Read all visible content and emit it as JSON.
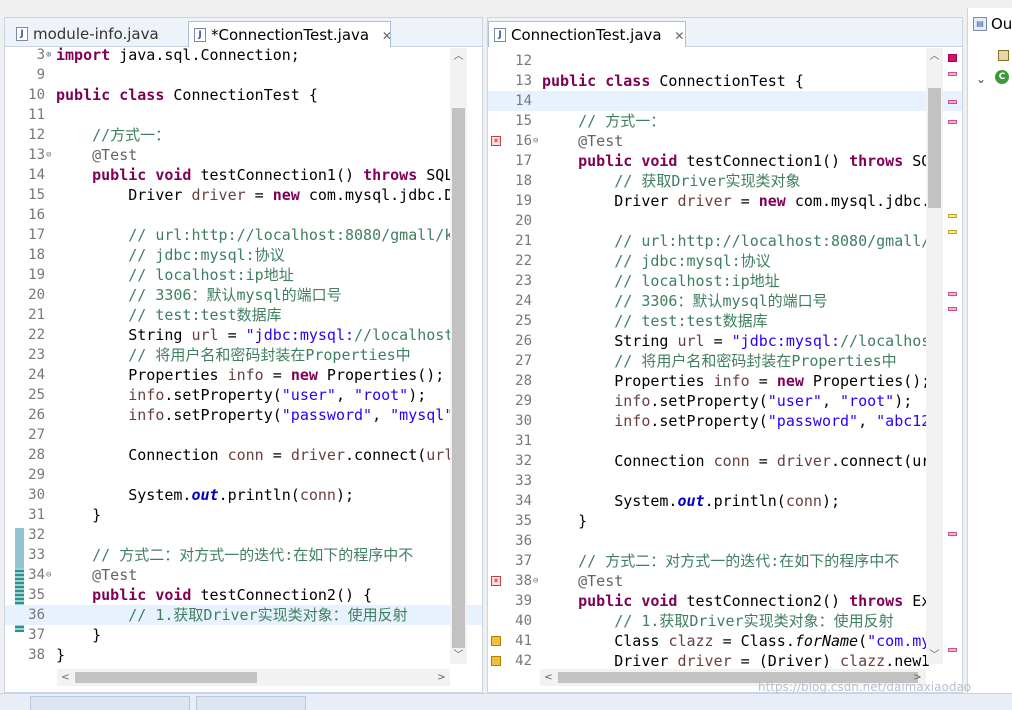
{
  "left_editor": {
    "tabs": [
      {
        "label": "module-info.java",
        "active": false
      },
      {
        "label": "*ConnectionTest.java",
        "active": true
      }
    ],
    "lines": [
      {
        "n": "3",
        "code": "import java.sql.Connection;",
        "fold": "plus"
      },
      {
        "n": "9",
        "code": ""
      },
      {
        "n": "10",
        "code": "public class ConnectionTest {"
      },
      {
        "n": "11",
        "code": ""
      },
      {
        "n": "12",
        "code": "    //方式一："
      },
      {
        "n": "13",
        "code": "    @Test",
        "fold": "minus"
      },
      {
        "n": "14",
        "code": "    public void testConnection1() throws SQL"
      },
      {
        "n": "15",
        "code": "        Driver driver = new com.mysql.jdbc.D"
      },
      {
        "n": "16",
        "code": ""
      },
      {
        "n": "17",
        "code": "        // url:http://localhost:8080/gmall/k"
      },
      {
        "n": "18",
        "code": "        // jdbc:mysql:协议"
      },
      {
        "n": "19",
        "code": "        // localhost:ip地址"
      },
      {
        "n": "20",
        "code": "        // 3306：默认mysql的端口号"
      },
      {
        "n": "21",
        "code": "        // test:test数据库"
      },
      {
        "n": "22",
        "code": "        String url = \"jdbc:mysql://localhost"
      },
      {
        "n": "23",
        "code": "        // 将用户名和密码封装在Properties中"
      },
      {
        "n": "24",
        "code": "        Properties info = new Properties();"
      },
      {
        "n": "25",
        "code": "        info.setProperty(\"user\", \"root\");"
      },
      {
        "n": "26",
        "code": "        info.setProperty(\"password\", \"mysql\""
      },
      {
        "n": "27",
        "code": ""
      },
      {
        "n": "28",
        "code": "        Connection conn = driver.connect(url"
      },
      {
        "n": "29",
        "code": ""
      },
      {
        "n": "30",
        "code": "        System.out.println(conn);"
      },
      {
        "n": "31",
        "code": "    }"
      },
      {
        "n": "32",
        "code": ""
      },
      {
        "n": "33",
        "code": "    // 方式二：对方式一的迭代:在如下的程序中不"
      },
      {
        "n": "34",
        "code": "    @Test",
        "fold": "minus"
      },
      {
        "n": "35",
        "code": "    public void testConnection2() {"
      },
      {
        "n": "36",
        "code": "        // 1.获取Driver实现类对象：使用反射",
        "highlight": true
      },
      {
        "n": "37",
        "code": "    }"
      },
      {
        "n": "38",
        "code": "}"
      }
    ]
  },
  "right_editor": {
    "tabs": [
      {
        "label": "ConnectionTest.java",
        "active": true
      }
    ],
    "lines": [
      {
        "n": "12",
        "code": ""
      },
      {
        "n": "13",
        "code": "public class ConnectionTest {"
      },
      {
        "n": "14",
        "code": "",
        "highlight": true
      },
      {
        "n": "15",
        "code": "    // 方式一："
      },
      {
        "n": "16",
        "code": "    @Test",
        "fold": "minus",
        "marker": "error"
      },
      {
        "n": "17",
        "code": "    public void testConnection1() throws SQ"
      },
      {
        "n": "18",
        "code": "        // 获取Driver实现类对象"
      },
      {
        "n": "19",
        "code": "        Driver driver = new com.mysql.jdbc."
      },
      {
        "n": "20",
        "code": ""
      },
      {
        "n": "21",
        "code": "        // url:http://localhost:8080/gmall/"
      },
      {
        "n": "22",
        "code": "        // jdbc:mysql:协议"
      },
      {
        "n": "23",
        "code": "        // localhost:ip地址"
      },
      {
        "n": "24",
        "code": "        // 3306：默认mysql的端口号"
      },
      {
        "n": "25",
        "code": "        // test:test数据库"
      },
      {
        "n": "26",
        "code": "        String url = \"jdbc:mysql://localhos"
      },
      {
        "n": "27",
        "code": "        // 将用户名和密码封装在Properties中"
      },
      {
        "n": "28",
        "code": "        Properties info = new Properties();"
      },
      {
        "n": "29",
        "code": "        info.setProperty(\"user\", \"root\");"
      },
      {
        "n": "30",
        "code": "        info.setProperty(\"password\", \"abc12"
      },
      {
        "n": "31",
        "code": ""
      },
      {
        "n": "32",
        "code": "        Connection conn = driver.connect(ur"
      },
      {
        "n": "33",
        "code": ""
      },
      {
        "n": "34",
        "code": "        System.out.println(conn);"
      },
      {
        "n": "35",
        "code": "    }"
      },
      {
        "n": "36",
        "code": ""
      },
      {
        "n": "37",
        "code": "    // 方式二：对方式一的迭代:在如下的程序中不"
      },
      {
        "n": "38",
        "code": "    @Test",
        "fold": "minus",
        "marker": "error"
      },
      {
        "n": "39",
        "code": "    public void testConnection2() throws Ex"
      },
      {
        "n": "40",
        "code": "        // 1.获取Driver实现类对象：使用反射"
      },
      {
        "n": "41",
        "code": "        Class clazz = Class.forName(\"com.my",
        "marker": "warning"
      },
      {
        "n": "42",
        "code": "        Driver driver = (Driver) clazz.newI",
        "marker": "warning"
      }
    ]
  },
  "outline": {
    "title": "Ou"
  },
  "watermark": "https://blog.csdn.net/daimaxiaodao",
  "colors": {
    "keyword": "#7f0055",
    "comment": "#3f7f5f",
    "string": "#2a00ff",
    "annotation": "#646464",
    "field": "#0000c0",
    "variable": "#6a3e3e",
    "current_line": "#e8f2fe"
  }
}
